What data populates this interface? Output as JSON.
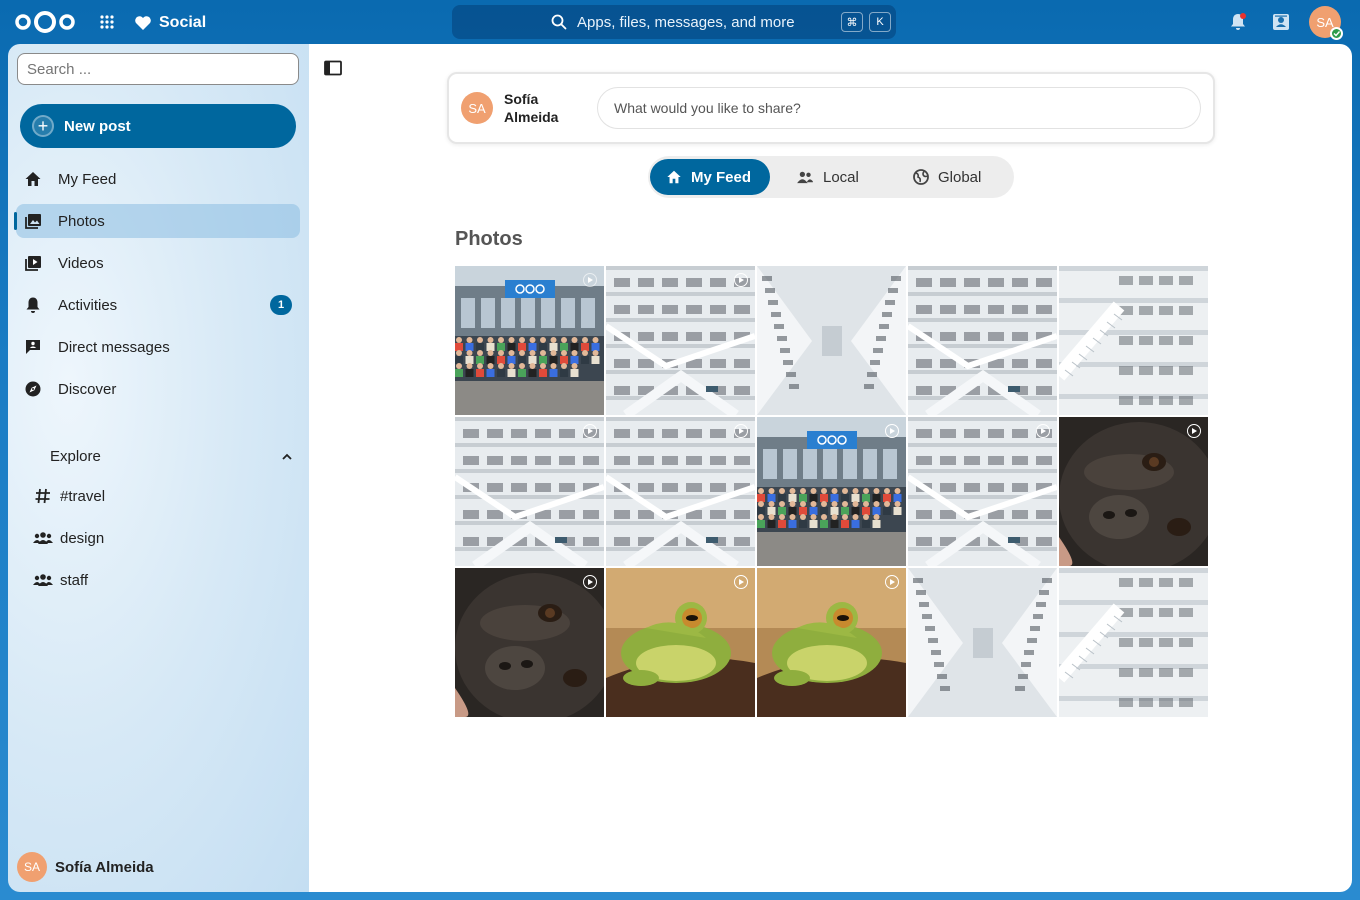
{
  "header": {
    "app_name": "Social",
    "search_placeholder": "Apps, files, messages, and more",
    "shortcut_keys": [
      "⌘",
      "K"
    ],
    "user_initials": "SA",
    "accent_color": "#00679e"
  },
  "sidebar": {
    "search_placeholder": "Search ...",
    "new_post_label": "New post",
    "items": [
      {
        "label": "My Feed",
        "icon": "home-icon",
        "active": false
      },
      {
        "label": "Photos",
        "icon": "image-icon",
        "active": true
      },
      {
        "label": "Videos",
        "icon": "video-icon",
        "active": false
      },
      {
        "label": "Activities",
        "icon": "bell-icon",
        "active": false,
        "badge": "1"
      },
      {
        "label": "Direct messages",
        "icon": "message-icon",
        "active": false
      },
      {
        "label": "Discover",
        "icon": "compass-icon",
        "active": false
      }
    ],
    "explore_label": "Explore",
    "explore_items": [
      {
        "label": "#travel",
        "icon": "hashtag-icon"
      },
      {
        "label": "design",
        "icon": "group-icon"
      },
      {
        "label": "staff",
        "icon": "group-icon"
      }
    ],
    "user": {
      "name": "Sofía Almeida",
      "initials": "SA"
    }
  },
  "main": {
    "composer": {
      "user_name": "Sofía Almeida",
      "user_initials": "SA",
      "placeholder": "What would you like to share?"
    },
    "tabs": [
      {
        "label": "My Feed",
        "icon": "home-icon",
        "active": true
      },
      {
        "label": "Local",
        "icon": "group-icon",
        "active": false
      },
      {
        "label": "Global",
        "icon": "globe-icon",
        "active": false
      }
    ],
    "section_title": "Photos",
    "photos": [
      {
        "subject": "group-photo",
        "video": true
      },
      {
        "subject": "library",
        "video": true
      },
      {
        "subject": "library-aisle",
        "video": false
      },
      {
        "subject": "library",
        "video": false
      },
      {
        "subject": "library-stairs",
        "video": false
      },
      {
        "subject": "library",
        "video": true
      },
      {
        "subject": "library",
        "video": true
      },
      {
        "subject": "group-photo",
        "video": true
      },
      {
        "subject": "library",
        "video": true
      },
      {
        "subject": "gorilla",
        "video": true
      },
      {
        "subject": "gorilla",
        "video": true
      },
      {
        "subject": "frog",
        "video": true
      },
      {
        "subject": "frog",
        "video": true
      },
      {
        "subject": "library-aisle",
        "video": false
      },
      {
        "subject": "library-stairs",
        "video": false
      }
    ]
  }
}
